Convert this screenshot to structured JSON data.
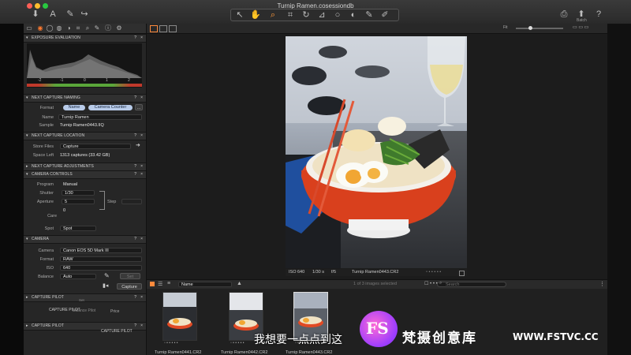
{
  "window": {
    "title": "Turnip Ramen.cosessiondb"
  },
  "toolbar": {
    "left_icons": [
      "import-icon",
      "text-icon",
      "brush-icon",
      "forward-icon"
    ],
    "right_icons": [
      "printer-icon",
      "export-icon",
      "help-icon"
    ],
    "right_label_export": "Batch"
  },
  "panels": {
    "exposure": {
      "title": "EXPOSURE EVALUATION",
      "scale": [
        "-2",
        "-1",
        "0",
        "1",
        "2"
      ]
    },
    "naming": {
      "title": "NEXT CAPTURE NAMING",
      "format_label": "Format",
      "format_tokens": [
        "Name",
        "Camera Counter"
      ],
      "more_label": "...",
      "name_label": "Name",
      "name_value": "Turnip Ramen",
      "sample_label": "Sample",
      "sample_value": "Turnip Ramen0443.IIQ"
    },
    "location": {
      "title": "NEXT CAPTURE LOCATION",
      "store_label": "Store Files",
      "store_value": "Capture",
      "space_label": "Space Left",
      "space_value": "1313 captures (33.42 GB)"
    },
    "adjustments": {
      "title": "NEXT CAPTURE ADJUSTMENTS"
    },
    "camera_controls": {
      "title": "CAMERA CONTROLS",
      "program_label": "Program",
      "program_value": "Manual",
      "shutter_label": "Shutter",
      "shutter_value": "1/30",
      "aperture_label": "Aperture",
      "aperture_value": "5",
      "step_label": "Step",
      "ev_value": "0",
      "care_label": "Care",
      "spot_label": "Spot",
      "spot_value": "Spot"
    },
    "camera": {
      "title": "CAMERA",
      "camera_label": "Camera",
      "camera_value": "Canon EOS 5D Mark III",
      "format_label": "Format",
      "format_value": "RAW",
      "iso_label": "ISO",
      "iso_value": "640",
      "balance_label": "Balance",
      "balance_value": "Auto",
      "set_label": "Set",
      "capture_button": "Capture"
    },
    "capture_pilot": {
      "title": "CAPTURE PILOT",
      "ghost_a": "CAPTURE PILOT",
      "ghost_b": "Balance Pilot",
      "ghost_c": "Price",
      "ghost_d": "Set"
    },
    "capture_pilot2": {
      "title": "CAPTURE PILOT",
      "ghost_a": "CAPTURE PILOT"
    }
  },
  "viewer": {
    "meta": {
      "iso": "ISO 640",
      "shutter": "1/30 s",
      "aperture": "f/5",
      "filename": "Turnip Ramen0443.CR2"
    },
    "fit_label": "Fit"
  },
  "browser": {
    "sort_value": "Name",
    "count_text": "1 of 3 images selected",
    "search_placeholder": "Search",
    "thumbnails": [
      {
        "caption": "Turnip Ramen0441.CR2"
      },
      {
        "caption": "Turnip Ramen0442.CR2"
      },
      {
        "caption": "Turnip Ramen0443.CR2"
      }
    ]
  },
  "overlay": {
    "subtitle": "我想要一点点到这",
    "brand": "梵摄创意库",
    "url": "WWW.FSTVC.CC",
    "logo_letters": "FS"
  },
  "colors": {
    "accent_pill": "#b8cbe9",
    "bowl_orange": "#e14a24",
    "panel_bg": "#262626"
  }
}
